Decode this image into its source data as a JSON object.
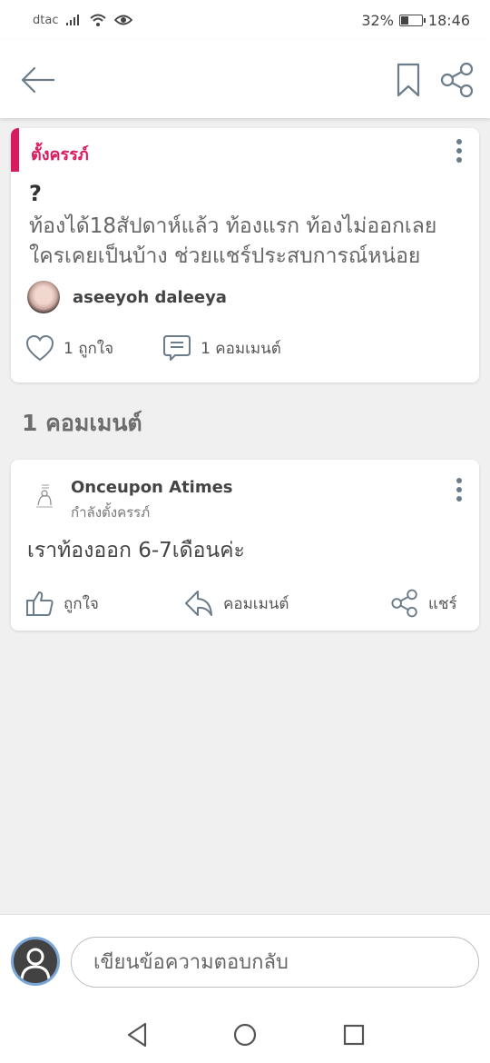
{
  "status": {
    "carrier": "dtac",
    "battery_percent": "32%",
    "battery_level": 0.32,
    "time": "18:46"
  },
  "topbar": {
    "back_icon": "arrow-left-icon",
    "bookmark_icon": "bookmark-icon",
    "share_icon": "share-icon"
  },
  "post": {
    "type_label": "ตั้งครรภ์",
    "title": "?",
    "body": "ท้องได้18สัปดาห์แล้ว ท้องแรก ท้องไม่ออกเลย ใครเคยเป็นบ้าง ช่วยแชร์ประสบการณ์หน่อย",
    "author": "aseeyoh daleeya",
    "likes_label": "1 ถูกใจ",
    "comments_label": "1 คอมเมนต์"
  },
  "comments_heading": "1 คอมเมนต์",
  "comment": {
    "user": "Onceupon Atimes",
    "subtitle": "กำลังตั้งครรภ์",
    "text": "เราท้องออก 6-7เดือนค่ะ",
    "like_label": "ถูกใจ",
    "reply_label": "คอมเมนต์",
    "share_label": "แชร์"
  },
  "reply": {
    "placeholder": "เขียนข้อความตอบกลับ"
  },
  "colors": {
    "accent": "#d81b60",
    "icon": "#6b7c8a"
  }
}
